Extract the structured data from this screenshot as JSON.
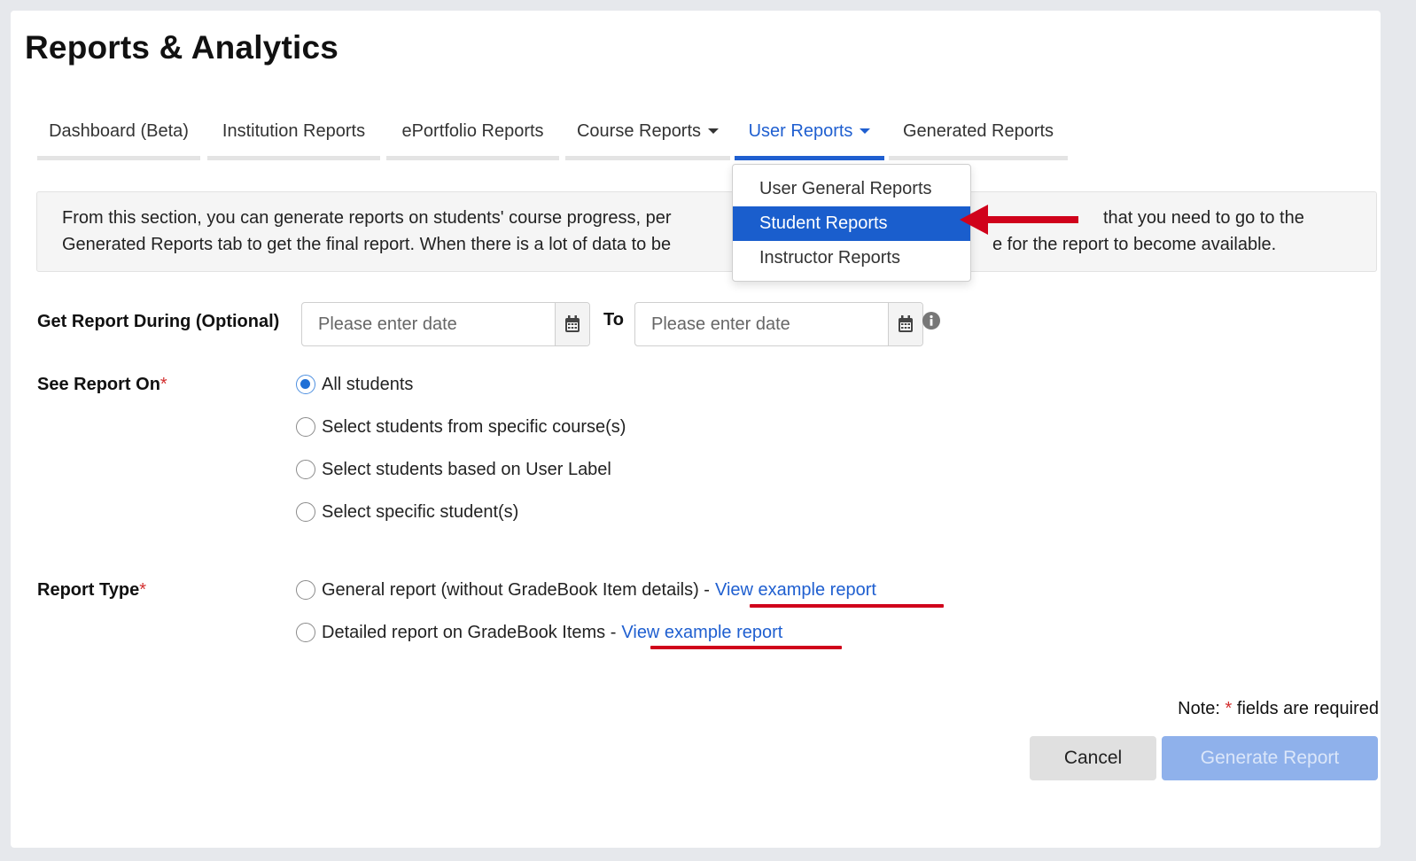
{
  "page_title": "Reports & Analytics",
  "tabs": [
    {
      "label": "Dashboard (Beta)"
    },
    {
      "label": "Institution Reports"
    },
    {
      "label": "ePortfolio Reports"
    },
    {
      "label": "Course Reports"
    },
    {
      "label": "User Reports"
    },
    {
      "label": "Generated Reports"
    }
  ],
  "active_tab": "User Reports",
  "dropdown": {
    "items": [
      "User General Reports",
      "Student Reports",
      "Instructor Reports"
    ],
    "selected": "Student Reports"
  },
  "info_text": {
    "line1_left": "From this section, you can generate reports on students' course progress, per",
    "line1_right": "that you need to go to the",
    "line2_left": "Generated Reports tab to get the final report. When there is a lot of data to be",
    "line2_right": "e for the report to become available."
  },
  "date_range": {
    "label": "Get Report During (Optional)",
    "from_placeholder": "Please enter date",
    "to_label": "To",
    "to_placeholder": "Please enter date"
  },
  "see_report_on": {
    "label": "See Report On",
    "required_mark": "*",
    "options": [
      "All students",
      "Select students from specific course(s)",
      "Select students based on User Label",
      "Select specific student(s)"
    ],
    "selected": "All students"
  },
  "report_type": {
    "label": "Report Type",
    "required_mark": "*",
    "options": [
      {
        "text": "General report (without GradeBook Item details) -",
        "link": "View example report"
      },
      {
        "text": "Detailed report on GradeBook Items -",
        "link": "View example report"
      }
    ]
  },
  "note": {
    "prefix": "Note:",
    "star": "*",
    "suffix": "fields are required"
  },
  "buttons": {
    "cancel": "Cancel",
    "generate": "Generate Report"
  },
  "colors": {
    "accent": "#1f5fd0",
    "highlight": "#1a5ecd",
    "annotation": "#d0021b",
    "generate_disabled": "#8fb1eb"
  }
}
